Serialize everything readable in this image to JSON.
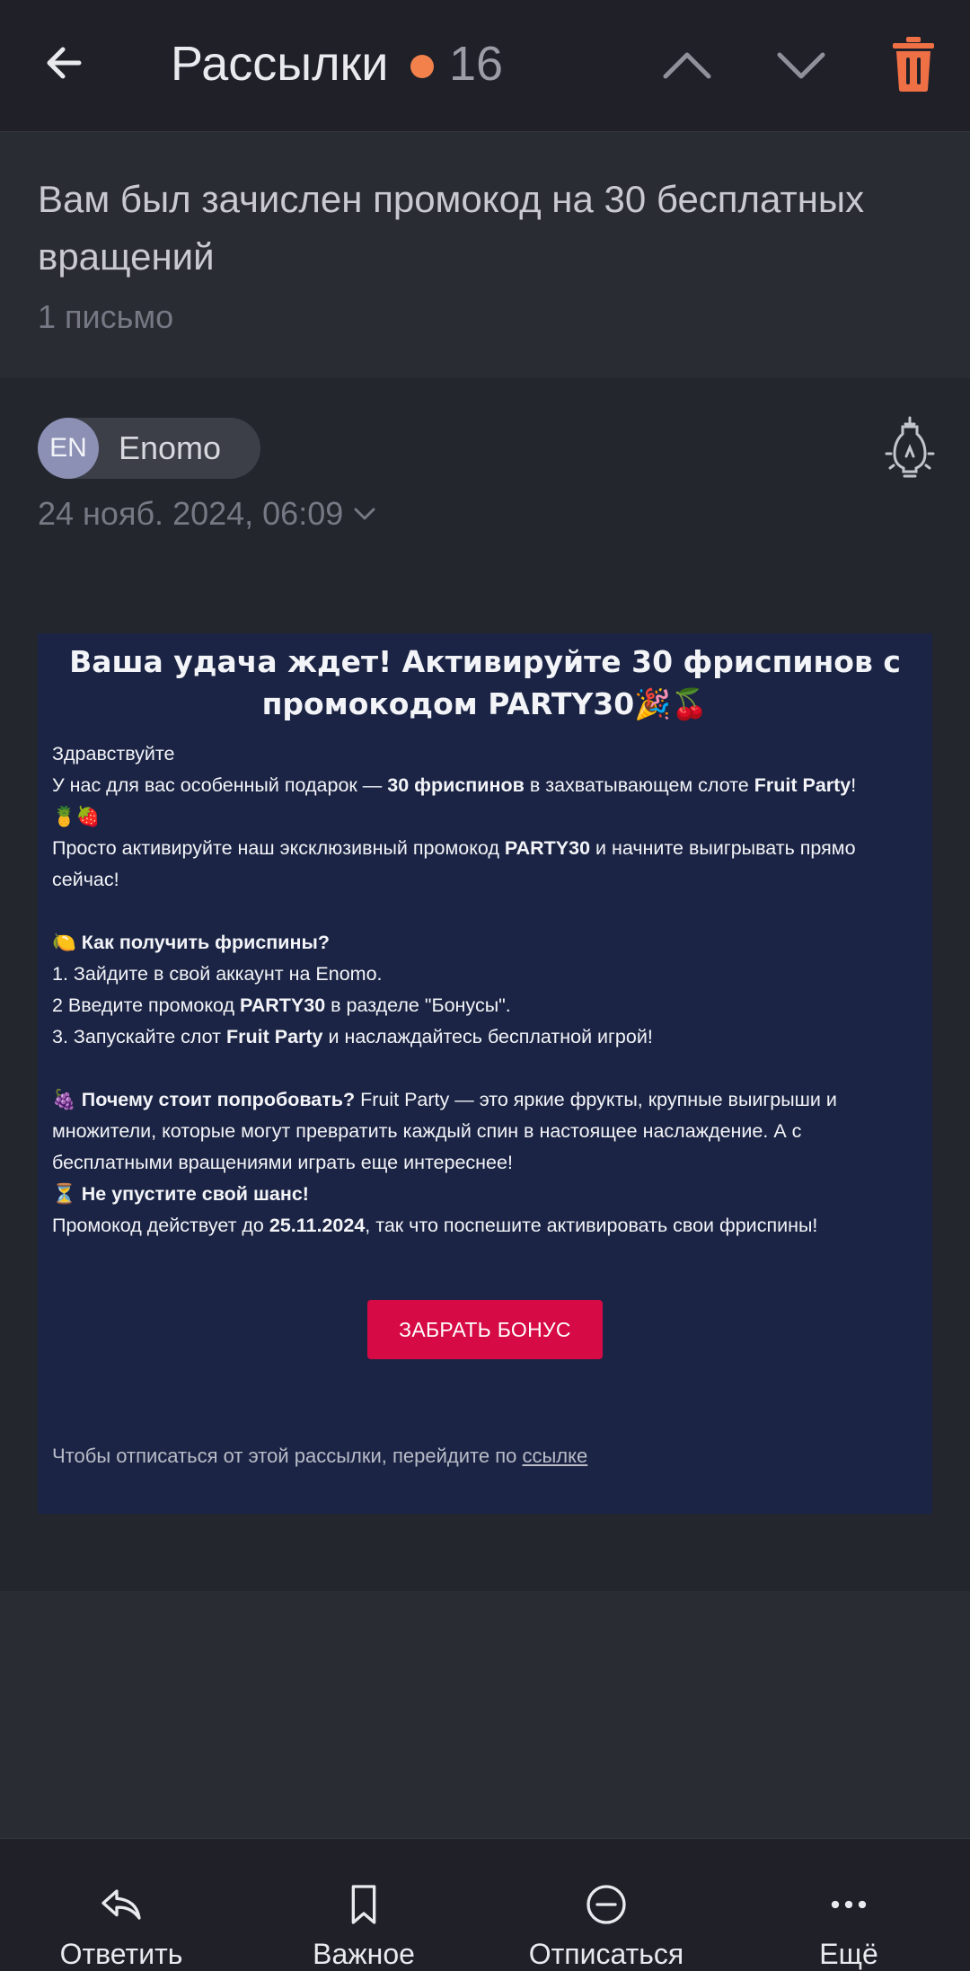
{
  "topbar": {
    "title": "Рассылки",
    "unread_count": "16",
    "accent_color": "#f2814b",
    "icons": [
      "arrow-left-icon",
      "chevron-up-icon",
      "chevron-down-icon",
      "trash-icon"
    ]
  },
  "thread": {
    "subject": "Вам был зачислен промокод на 30 бесплатных вращений",
    "count": "1 письмо"
  },
  "message": {
    "sender_initials": "EN",
    "sender_name": "Enomo",
    "date": "24 нояб. 2024, 06:09",
    "title": "Ваша удача ждет! Активируйте 30 фриспинов с промокодом PARTY30🎉🍒",
    "body": {
      "greeting": "Здравствуйте",
      "l1_a": "У нас для вас особенный подарок — ",
      "l1_b": "30 фриспинов",
      "l1_c": " в захватывающем слоте ",
      "l1_d": "Fruit Party",
      "l1_e": "!",
      "l1_emoji": "🍍🍓",
      "l2_a": "Просто активируйте наш эксклюзивный промокод ",
      "l2_b": "PARTY30",
      "l2_c": " и начните выигрывать прямо сейчас!",
      "how_emoji": "🍋",
      "how_title": "Как получить фриспины?",
      "step1": "1. Зайдите в свой аккаунт на Enomo.",
      "step2_a": "2 Введите промокод ",
      "step2_b": "PARTY30",
      "step2_c": " в разделе \"Бонусы\".",
      "step3_a": "3. Запускайте слот ",
      "step3_b": "Fruit Party",
      "step3_c": " и наслаждайтесь бесплатной игрой!",
      "why_emoji": "🍇",
      "why_title": "Почему стоит попробовать?",
      "why_text": " Fruit Party — это яркие фрукты, крупные выигрыши и множители, которые могут превратить каждый спин в настоящее наслаждение. А с бесплатными вращениями играть еще интереснее!",
      "chance_emoji": "⏳",
      "chance_title": "Не упустите свой шанс!",
      "promo_a": "Промокод действует до ",
      "promo_b": "25.11.2024",
      "promo_c": ", так что поспешите активировать свои фриспины!"
    },
    "cta_label": "ЗАБРАТЬ БОНУС",
    "cta_color": "#d60a44",
    "unsub_text": "Чтобы отписаться от этой рассылки, перейдите по ",
    "unsub_link": "ссылке"
  },
  "bottombar": {
    "reply": "Ответить",
    "important": "Важное",
    "unsubscribe": "Отписаться",
    "more": "Ещё"
  }
}
